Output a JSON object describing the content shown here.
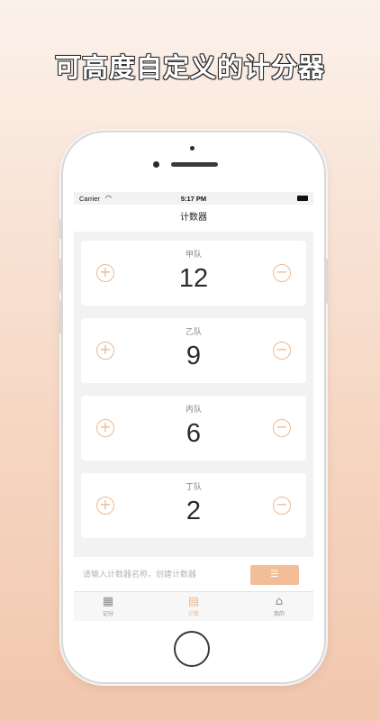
{
  "headline": "可高度自定义的计分器",
  "status_bar": {
    "carrier": "Carrier",
    "time": "5:17 PM"
  },
  "nav": {
    "title": "计数器"
  },
  "counters": [
    {
      "name": "甲队",
      "value": "12"
    },
    {
      "name": "乙队",
      "value": "9"
    },
    {
      "name": "丙队",
      "value": "6"
    },
    {
      "name": "丁队",
      "value": "2"
    }
  ],
  "controls": {
    "plus_symbol": "+",
    "minus_symbol": "−"
  },
  "create": {
    "placeholder": "请输入计数器名称，创建计数器",
    "button_icon": "☰"
  },
  "tabs": [
    {
      "label": "记分",
      "icon": "calendar-icon",
      "glyph": "▦"
    },
    {
      "label": "计数",
      "icon": "counter-icon",
      "glyph": "▤",
      "active": true
    },
    {
      "label": "我的",
      "icon": "home-icon",
      "glyph": "⌂"
    }
  ],
  "colors": {
    "accent": "#efb98f",
    "button": "#f1be98"
  }
}
